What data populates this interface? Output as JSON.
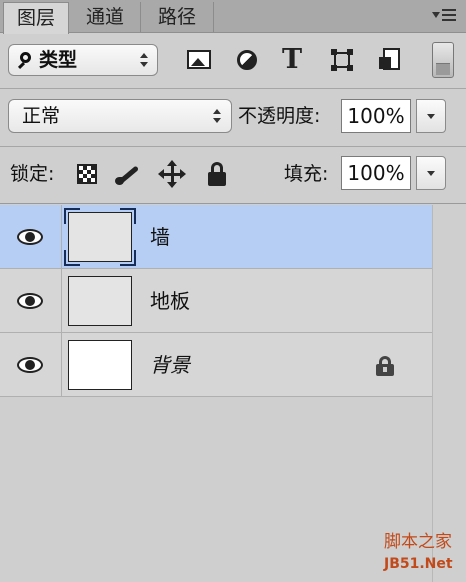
{
  "tabs": [
    {
      "label": "图层",
      "active": true
    },
    {
      "label": "通道",
      "active": false
    },
    {
      "label": "路径",
      "active": false
    }
  ],
  "filter": {
    "kind_label": "类型",
    "icons": [
      "pixel-layer-filter-icon",
      "adjustment-layer-filter-icon",
      "type-layer-filter-icon",
      "shape-layer-filter-icon",
      "smart-object-filter-icon"
    ],
    "type_glyph": "T"
  },
  "blend": {
    "mode": "正常",
    "opacity_label": "不透明度:",
    "opacity_value": "100%"
  },
  "lock": {
    "label": "锁定:",
    "icons": [
      "lock-transparent-pixels-icon",
      "lock-image-pixels-icon",
      "lock-position-icon",
      "lock-all-icon"
    ],
    "fill_label": "填充:",
    "fill_value": "100%"
  },
  "layers": [
    {
      "name": "墙",
      "selected": true,
      "visible": true,
      "locked": false
    },
    {
      "name": "地板",
      "selected": false,
      "visible": true,
      "locked": false
    },
    {
      "name": "背景",
      "selected": false,
      "visible": true,
      "locked": true
    }
  ],
  "watermark": {
    "line1": "脚本之家",
    "line2": "JB51.Net"
  },
  "colors": {
    "selected_row": "#b7cef4",
    "panel_bg": "#d6d6d6",
    "watermark": "#c24a1a"
  }
}
